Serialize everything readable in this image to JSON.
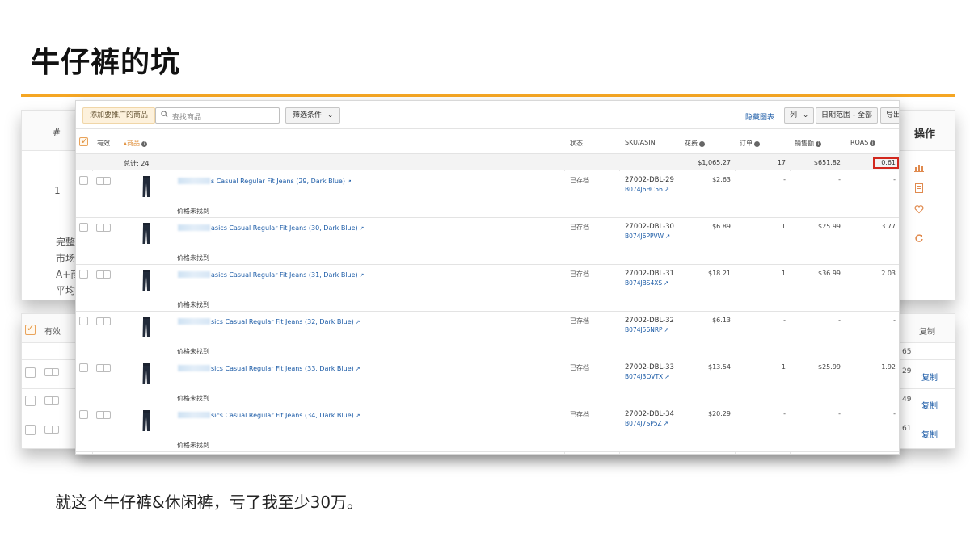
{
  "slide": {
    "title": "牛仔裤的坑",
    "caption": "就这个牛仔裤&休闲裤，亏了我至少30万。"
  },
  "background_top": {
    "hash_header": "#",
    "ops_header": "操作",
    "row_number": "1",
    "side_labels": [
      "完整",
      "市场",
      "A+商",
      "平均"
    ]
  },
  "background_bottom": {
    "enabled_header": "有效",
    "copy_header": "复制",
    "copy_links": [
      "复制",
      "复制",
      "复制"
    ],
    "right_values": [
      "65",
      "29",
      "49",
      "61"
    ]
  },
  "toolbar": {
    "add_button": "添加要推广的商品",
    "search_placeholder": "查找商品",
    "filter_button": "筛选条件",
    "hide_chart_link": "隐藏图表",
    "columns_button": "列",
    "date_range_button": "日期范围 - 全部",
    "export_button": "导出"
  },
  "table": {
    "headers": {
      "enabled": "有效",
      "product": "商品",
      "status": "状态",
      "sku_asin": "SKU/ASIN",
      "spend": "花费",
      "orders": "订单",
      "sales": "销售额",
      "roas": "ROAS"
    },
    "totals": {
      "label": "总计: 24",
      "spend": "$1,065.27",
      "orders": "17",
      "sales": "$651.82",
      "roas": "0.61"
    },
    "rows": [
      {
        "name": "s Casual Regular Fit Jeans (29, Dark Blue)",
        "price": "价格未找到",
        "status": "已存档",
        "sku": "27002-DBL-29",
        "asin": "B074J6HC56",
        "spend": "$2.63",
        "orders": "-",
        "sales": "-",
        "roas": "-"
      },
      {
        "name": "asics Casual Regular Fit Jeans (30, Dark Blue)",
        "price": "价格未找到",
        "status": "已存档",
        "sku": "27002-DBL-30",
        "asin": "B074J6PPVW",
        "spend": "$6.89",
        "orders": "1",
        "sales": "$25.99",
        "roas": "3.77"
      },
      {
        "name": "asics Casual Regular Fit Jeans (31, Dark Blue)",
        "price": "价格未找到",
        "status": "已存档",
        "sku": "27002-DBL-31",
        "asin": "B074JBS4XS",
        "spend": "$18.21",
        "orders": "1",
        "sales": "$36.99",
        "roas": "2.03"
      },
      {
        "name": "sics Casual Regular Fit Jeans (32, Dark Blue)",
        "price": "价格未找到",
        "status": "已存档",
        "sku": "27002-DBL-32",
        "asin": "B074J56NRP",
        "spend": "$6.13",
        "orders": "-",
        "sales": "-",
        "roas": "-"
      },
      {
        "name": "sics Casual Regular Fit Jeans (33, Dark Blue)",
        "price": "价格未找到",
        "status": "已存档",
        "sku": "27002-DBL-33",
        "asin": "B074J3QVTX",
        "spend": "$13.54",
        "orders": "1",
        "sales": "$25.99",
        "roas": "1.92"
      },
      {
        "name": "sics Casual Regular Fit Jeans (34, Dark Blue)",
        "price": "价格未找到",
        "status": "已存档",
        "sku": "27002-DBL-34",
        "asin": "B074J7SP5Z",
        "spend": "$20.29",
        "orders": "-",
        "sales": "-",
        "roas": "-"
      }
    ]
  },
  "colors": {
    "accent_rule": "#f5a623",
    "link": "#1a5aa6",
    "roas_highlight": "#d2281e"
  },
  "icons": [
    "search-icon",
    "chevron-down-icon",
    "info-icon",
    "external-link-icon",
    "sort-up-icon",
    "chart-icon",
    "document-icon",
    "heart-icon",
    "refresh-icon",
    "jeans-icon"
  ]
}
